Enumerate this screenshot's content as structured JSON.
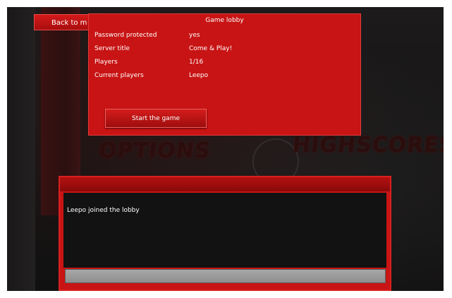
{
  "back_button": {
    "label": "Back to m"
  },
  "background": {
    "options_text": "OPTIONS",
    "highscores_text": "HIGHSCORES"
  },
  "lobby": {
    "title": "Game lobby",
    "rows": [
      {
        "label": "Password protected",
        "value": "yes"
      },
      {
        "label": "Server title",
        "value": "Come & Play!"
      },
      {
        "label": "Players",
        "value": "1/16"
      },
      {
        "label": "Current players",
        "value": "Leepo"
      }
    ],
    "start_label": "Start the game"
  },
  "chat": {
    "messages": [
      "Leepo joined the lobby"
    ],
    "input_value": ""
  },
  "colors": {
    "panel_red": "#c81414",
    "button_red": "#b81212",
    "chat_bg": "#121212",
    "input_gray": "#9a9a9a"
  }
}
